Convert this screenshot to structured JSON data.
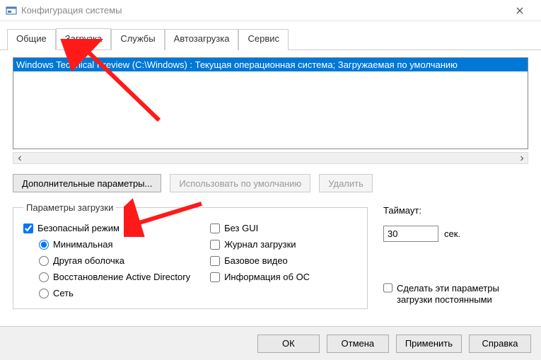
{
  "window": {
    "title": "Конфигурация системы"
  },
  "tabs": {
    "general": "Общие",
    "boot": "Загрузка",
    "services": "Службы",
    "startup": "Автозагрузка",
    "tools": "Сервис",
    "active": 1
  },
  "bootlist": {
    "item0": "Windows Technical Preview (C:\\Windows) : Текущая операционная система; Загружаемая по умолчанию"
  },
  "buttons": {
    "advanced": "Дополнительные параметры...",
    "setdefault": "Использовать по умолчанию",
    "delete": "Удалить"
  },
  "bootopts": {
    "legend": "Параметры загрузки",
    "safeboot": "Безопасный режим",
    "minimal": "Минимальная",
    "altshell": "Другая оболочка",
    "dsrepair": "Восстановление Active Directory",
    "network": "Сеть",
    "nogui": "Без GUI",
    "bootlog": "Журнал загрузки",
    "basevideo": "Базовое видео",
    "osinfo": "Информация  об ОС"
  },
  "timeout": {
    "label": "Таймаут:",
    "value": "30",
    "suffix": "сек."
  },
  "persist": "Сделать эти параметры загрузки постоянными",
  "footer": {
    "ok": "ОК",
    "cancel": "Отмена",
    "apply": "Применить",
    "help": "Справка"
  }
}
